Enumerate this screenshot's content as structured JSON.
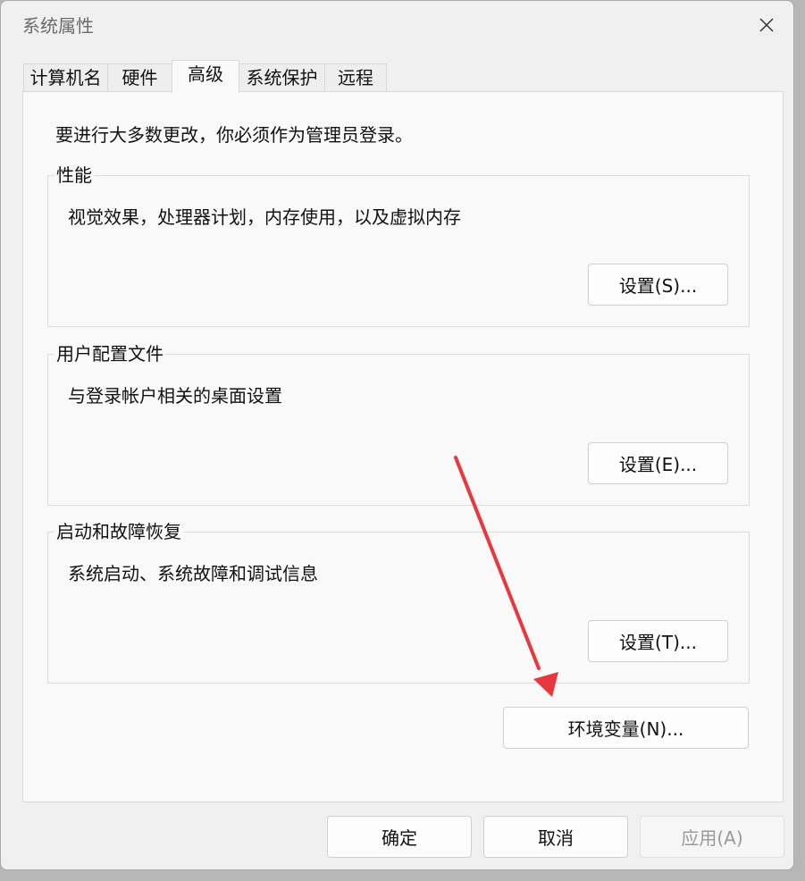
{
  "window": {
    "title": "系统属性",
    "close_icon": "close-icon"
  },
  "tabs": [
    {
      "label": "计算机名",
      "active": false
    },
    {
      "label": "硬件",
      "active": false
    },
    {
      "label": "高级",
      "active": true
    },
    {
      "label": "系统保护",
      "active": false
    },
    {
      "label": "远程",
      "active": false
    }
  ],
  "advanced": {
    "notice": "要进行大多数更改，你必须作为管理员登录。",
    "groups": [
      {
        "title": "性能",
        "description": "视觉效果，处理器计划，内存使用，以及虚拟内存",
        "button_label": "设置(S)..."
      },
      {
        "title": "用户配置文件",
        "description": "与登录帐户相关的桌面设置",
        "button_label": "设置(E)..."
      },
      {
        "title": "启动和故障恢复",
        "description": "系统启动、系统故障和调试信息",
        "button_label": "设置(T)..."
      }
    ],
    "env_button_label": "环境变量(N)..."
  },
  "footer": {
    "ok_label": "确定",
    "cancel_label": "取消",
    "apply_label": "应用(A)",
    "apply_enabled": false
  },
  "annotation": {
    "arrow_color": "#e8383d"
  }
}
